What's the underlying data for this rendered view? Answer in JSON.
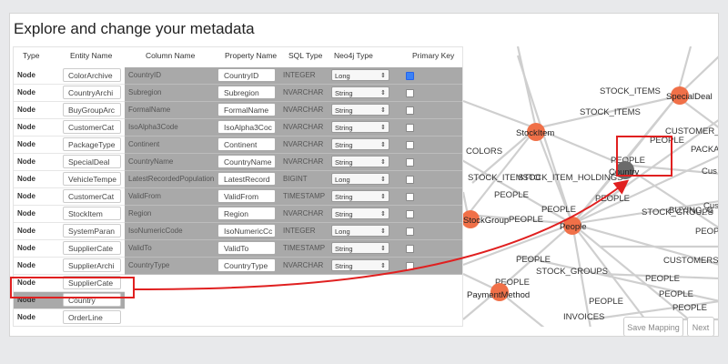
{
  "page": {
    "title": "Explore and change your metadata"
  },
  "table": {
    "headers": {
      "type": "Type",
      "entity_name": "Entity Name",
      "column_name": "Column Name",
      "property_name": "Property Name",
      "sql_type": "SQL Type",
      "neo4j_type": "Neo4j Type",
      "primary_key": "Primary Key"
    },
    "entities": [
      {
        "type": "Node",
        "name": "ColorArchive"
      },
      {
        "type": "Node",
        "name": "CountryArchi"
      },
      {
        "type": "Node",
        "name": "BuyGroupArc"
      },
      {
        "type": "Node",
        "name": "CustomerCat"
      },
      {
        "type": "Node",
        "name": "PackageType"
      },
      {
        "type": "Node",
        "name": "SpecialDeal"
      },
      {
        "type": "Node",
        "name": "VehicleTempe"
      },
      {
        "type": "Node",
        "name": "CustomerCat"
      },
      {
        "type": "Node",
        "name": "StockItem"
      },
      {
        "type": "Node",
        "name": "SystemParan"
      },
      {
        "type": "Node",
        "name": "SupplierCate"
      },
      {
        "type": "Node",
        "name": "SupplierArchi"
      },
      {
        "type": "Node",
        "name": "SupplierCate"
      },
      {
        "type": "Node",
        "name": "Country"
      },
      {
        "type": "Node",
        "name": "OrderLine"
      }
    ],
    "properties": [
      {
        "column": "CountryID",
        "property": "CountryID",
        "sql": "INTEGER",
        "neo4j": "Long",
        "pk": true
      },
      {
        "column": "Subregion",
        "property": "Subregion",
        "sql": "NVARCHAR",
        "neo4j": "String",
        "pk": false
      },
      {
        "column": "FormalName",
        "property": "FormalName",
        "sql": "NVARCHAR",
        "neo4j": "String",
        "pk": false
      },
      {
        "column": "IsoAlpha3Code",
        "property": "IsoAlpha3Coc",
        "sql": "NVARCHAR",
        "neo4j": "String",
        "pk": false
      },
      {
        "column": "Continent",
        "property": "Continent",
        "sql": "NVARCHAR",
        "neo4j": "String",
        "pk": false
      },
      {
        "column": "CountryName",
        "property": "CountryName",
        "sql": "NVARCHAR",
        "neo4j": "String",
        "pk": false
      },
      {
        "column": "LatestRecordedPopulation",
        "property": "LatestRecord",
        "sql": "BIGINT",
        "neo4j": "Long",
        "pk": false
      },
      {
        "column": "ValidFrom",
        "property": "ValidFrom",
        "sql": "TIMESTAMP",
        "neo4j": "String",
        "pk": false
      },
      {
        "column": "Region",
        "property": "Region",
        "sql": "NVARCHAR",
        "neo4j": "String",
        "pk": false
      },
      {
        "column": "IsoNumericCode",
        "property": "IsoNumericCc",
        "sql": "INTEGER",
        "neo4j": "Long",
        "pk": false
      },
      {
        "column": "ValidTo",
        "property": "ValidTo",
        "sql": "TIMESTAMP",
        "neo4j": "String",
        "pk": false
      },
      {
        "column": "CountryType",
        "property": "CountryType",
        "sql": "NVARCHAR",
        "neo4j": "String",
        "pk": false
      }
    ]
  },
  "graph": {
    "nodes": [
      {
        "label": "SpecialDeal",
        "color": "#f07048"
      },
      {
        "label": "StockItem",
        "color": "#f07048"
      },
      {
        "label": "Country",
        "color": "#6b6b6b"
      },
      {
        "label": "StockGroup",
        "color": "#f07048"
      },
      {
        "label": "People",
        "color": "#f07048"
      },
      {
        "label": "PaymentMethod",
        "color": "#f07048"
      }
    ],
    "edge_labels": [
      "STOCK_ITEMS",
      "STOCK_ITEMS",
      "CUSTOMER_CA",
      "PACKA",
      "COLORS",
      "PEOPLE",
      "PEOPLE",
      "STOCK_ITEMSTO",
      "STOCK_ITEM_HOLDINGS",
      "PEOPLE",
      "PEOPLE",
      "PEOPLE",
      "STOCK_GROUPS",
      "BUYING_G",
      "CUSTOMERS",
      "PEOPLE",
      "PEOPLE",
      "STOCK_GROUPS",
      "PEOPLE",
      "INVOICES",
      "PEOPLE",
      "PEOPLE",
      "PEOPLE",
      "PEOPLE",
      "Cus",
      "Cus",
      "PEOPLE"
    ]
  },
  "buttons": {
    "save_mapping": "Save Mapping",
    "next": "Next"
  },
  "colors": {
    "highlight": "#e02020",
    "node_orange": "#f07048",
    "node_gray": "#6b6b6b",
    "selected_bg": "#a9a9a9"
  }
}
